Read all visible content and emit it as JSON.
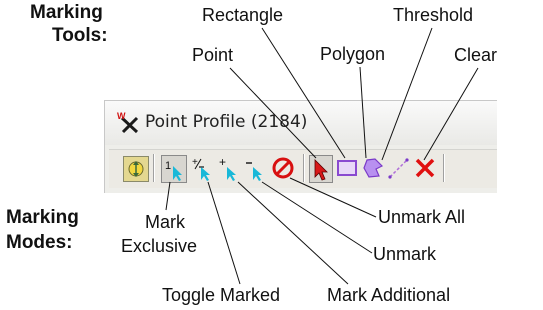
{
  "labels": {
    "marking_tools": "Marking\nTools:",
    "marking_tools_line1": "Marking",
    "marking_tools_line2": "Tools:",
    "marking_modes_line1": "Marking",
    "marking_modes_line2": "Modes:",
    "rectangle": "Rectangle",
    "threshold": "Threshold",
    "point": "Point",
    "polygon": "Polygon",
    "clear": "Clear",
    "mark_exclusive_line1": "Mark",
    "mark_exclusive_line2": "Exclusive",
    "unmark_all": "Unmark All",
    "unmark": "Unmark",
    "toggle_marked": "Toggle Marked",
    "mark_additional": "Mark Additional"
  },
  "window": {
    "title": "Point Profile (2184)"
  },
  "toolbar": {
    "mode_glyphs": {
      "exclusive": "1",
      "toggle": "+⁄−",
      "additional": "+",
      "unmark": "−"
    }
  },
  "colors": {
    "cursor_cyan": "#18b8d8",
    "pointer_red": "#d81818",
    "clear_red": "#e01010",
    "polygon_purple": "#9a5ad8",
    "rect_purple": "#8a4ad0",
    "unmark_all_red": "#d81010"
  },
  "icons": {
    "app": "point-profile-app-icon",
    "pan": "pan-zoom-icon",
    "mark_exclusive": "mark-exclusive-icon",
    "toggle_marked": "toggle-marked-icon",
    "mark_additional": "mark-additional-icon",
    "unmark": "unmark-icon",
    "unmark_all": "unmark-all-icon",
    "point": "point-tool-icon",
    "rectangle": "rectangle-tool-icon",
    "polygon": "polygon-tool-icon",
    "threshold": "threshold-tool-icon",
    "clear": "clear-tool-icon"
  }
}
